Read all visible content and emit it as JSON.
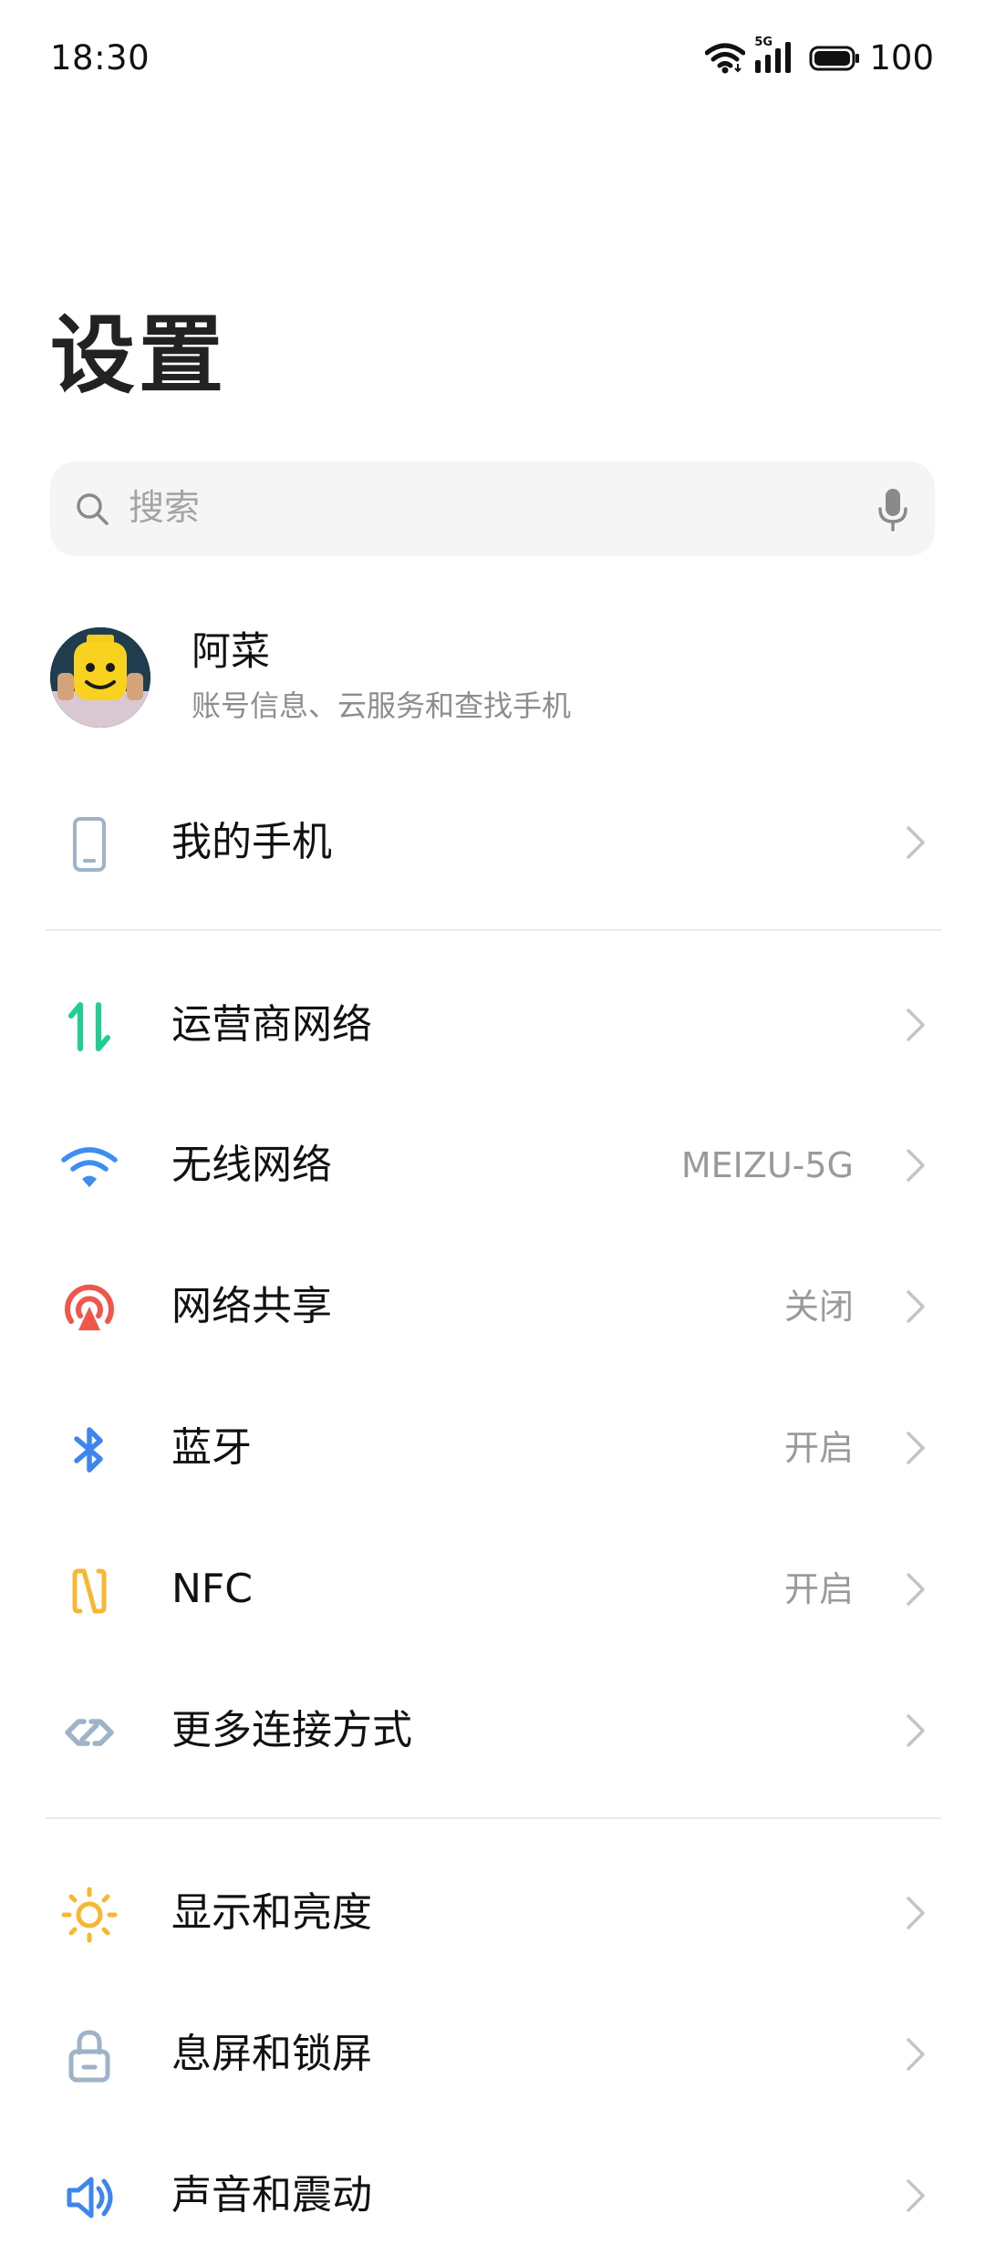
{
  "status_bar": {
    "time": "18:30",
    "network_badge": "5G",
    "battery_level": "100",
    "icons": [
      "wifi-icon",
      "cellular-signal-icon",
      "battery-icon"
    ]
  },
  "header": {
    "title": "设置"
  },
  "search": {
    "placeholder": "搜索",
    "icons": [
      "search-icon",
      "microphone-icon"
    ]
  },
  "account": {
    "name": "阿菜",
    "subtitle": "账号信息、云服务和查找手机"
  },
  "sections": [
    {
      "items": [
        {
          "label": "我的手机",
          "value": "",
          "icon": "phone-icon",
          "color": "#9fb3c8"
        }
      ]
    },
    {
      "items": [
        {
          "label": "运营商网络",
          "value": "",
          "icon": "data-arrows-icon",
          "color": "#1ecf95"
        },
        {
          "label": "无线网络",
          "value": "MEIZU-5G",
          "icon": "wifi-icon",
          "color": "#3d8ef0"
        },
        {
          "label": "网络共享",
          "value": "关闭",
          "icon": "hotspot-icon",
          "color": "#f0574a"
        },
        {
          "label": "蓝牙",
          "value": "开启",
          "icon": "bluetooth-icon",
          "color": "#3d86f0"
        },
        {
          "label": "NFC",
          "value": "开启",
          "icon": "nfc-icon",
          "color": "#f7b731"
        },
        {
          "label": "更多连接方式",
          "value": "",
          "icon": "link-icon",
          "color": "#9fb3c8"
        }
      ]
    },
    {
      "items": [
        {
          "label": "显示和亮度",
          "value": "",
          "icon": "sun-icon",
          "color": "#f7b731"
        },
        {
          "label": "息屏和锁屏",
          "value": "",
          "icon": "lock-icon",
          "color": "#9fb3c8"
        },
        {
          "label": "声音和震动",
          "value": "",
          "icon": "speaker-icon",
          "color": "#3d86f0"
        }
      ]
    }
  ]
}
